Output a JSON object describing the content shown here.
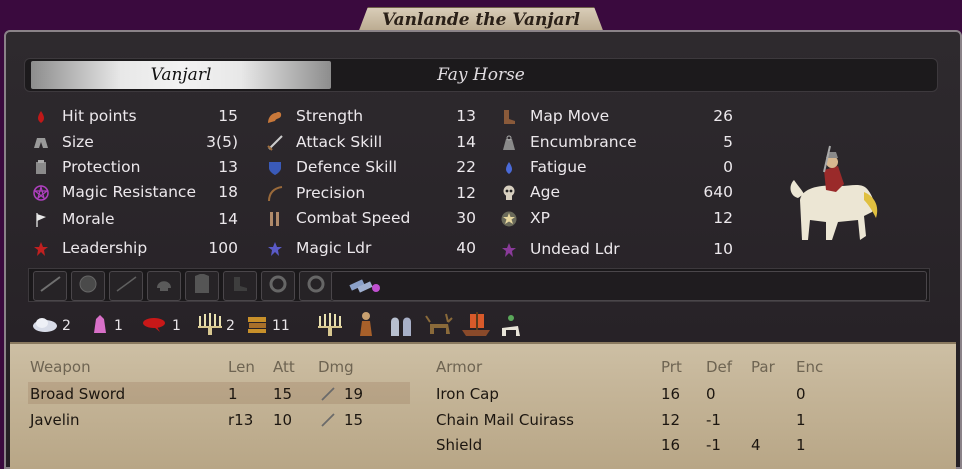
{
  "window": {
    "title": "Vanlande the Vanjarl"
  },
  "tabs": [
    {
      "label": "Vanjarl",
      "active": true
    },
    {
      "label": "Fay Horse",
      "active": false
    }
  ],
  "stats": {
    "col1": [
      {
        "label": "Hit points",
        "value": "15",
        "icon": "blood-drop-icon"
      },
      {
        "label": "Size",
        "value": "3(5)",
        "icon": "size-icon"
      },
      {
        "label": "Protection",
        "value": "13",
        "icon": "armor-icon"
      },
      {
        "label": "Magic Resistance",
        "value": "18",
        "icon": "pentagram-icon"
      },
      {
        "label": "Morale",
        "value": "14",
        "icon": "flag-icon"
      },
      {
        "label": "Leadership",
        "value": "100",
        "icon": "leadership-star-icon"
      }
    ],
    "col2": [
      {
        "label": "Strength",
        "value": "13",
        "icon": "flexed-arm-icon"
      },
      {
        "label": "Attack Skill",
        "value": "14",
        "icon": "sword-icon"
      },
      {
        "label": "Defence Skill",
        "value": "22",
        "icon": "shield-icon"
      },
      {
        "label": "Precision",
        "value": "12",
        "icon": "bow-icon"
      },
      {
        "label": "Combat Speed",
        "value": "30",
        "icon": "legs-icon"
      },
      {
        "label": "Magic Ldr",
        "value": "40",
        "icon": "magic-leader-icon"
      }
    ],
    "col3": [
      {
        "label": "Map Move",
        "value": "26",
        "icon": "boots-icon"
      },
      {
        "label": "Encumbrance",
        "value": "5",
        "icon": "weight-icon"
      },
      {
        "label": "Fatigue",
        "value": "0",
        "icon": "sweat-drop-icon"
      },
      {
        "label": "Age",
        "value": "640",
        "icon": "skull-icon"
      },
      {
        "label": "XP",
        "value": "12",
        "icon": "xp-star-icon"
      },
      {
        "label": "Undead Ldr",
        "value": "10",
        "icon": "undead-leader-icon"
      }
    ]
  },
  "gems": [
    {
      "icon": "cloud-gem-icon",
      "count": "2"
    },
    {
      "icon": "crystal-gem-icon",
      "count": "1"
    },
    {
      "icon": "blood-slave-icon",
      "count": "1"
    },
    {
      "icon": "candelabra-icon",
      "count": "2"
    },
    {
      "icon": "books-icon",
      "count": "11"
    }
  ],
  "misc_icons": [
    "candelabra-icon",
    "monk-icon",
    "ghosts-icon",
    "moose-icon",
    "longship-icon",
    "mounted-icon"
  ],
  "weapons": {
    "headers": {
      "name": "Weapon",
      "len": "Len",
      "att": "Att",
      "dmg": "Dmg"
    },
    "rows": [
      {
        "name": "Broad Sword",
        "len": "1",
        "att": "15",
        "dmg": "19"
      },
      {
        "name": "Javelin",
        "len": "r13",
        "att": "10",
        "dmg": "15"
      }
    ]
  },
  "armor": {
    "headers": {
      "name": "Armor",
      "prt": "Prt",
      "def": "Def",
      "par": "Par",
      "enc": "Enc"
    },
    "rows": [
      {
        "name": "Iron Cap",
        "prt": "16",
        "def": "0",
        "par": "",
        "enc": "0"
      },
      {
        "name": "Chain Mail Cuirass",
        "prt": "12",
        "def": "-1",
        "par": "",
        "enc": "1"
      },
      {
        "name": "Shield",
        "prt": "16",
        "def": "-1",
        "par": "4",
        "enc": "1"
      }
    ]
  },
  "colors": {
    "background": "#3a0a3e",
    "panel": "#2a262a",
    "parchment": "#c4b497"
  }
}
